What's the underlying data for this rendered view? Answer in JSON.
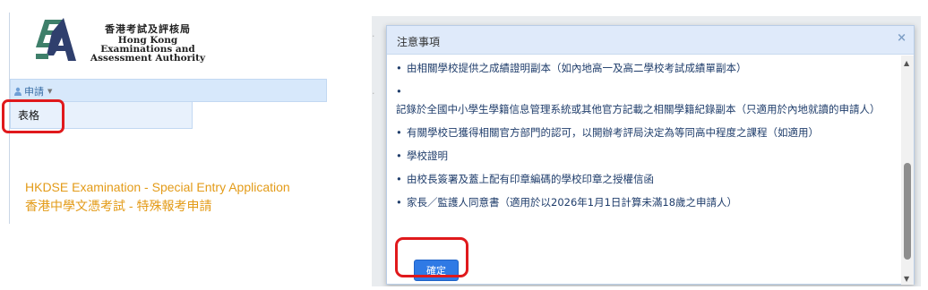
{
  "left": {
    "logo": {
      "chinese_name": "香港考試及評核局",
      "english_line1": "Hong Kong",
      "english_line2": "Examinations and",
      "english_line3": "Assessment Authority"
    },
    "menu": {
      "button_label": "申請",
      "item_label": "表格"
    },
    "page_title_en": "HKDSE Examination - Special Entry Application",
    "page_title_cn": "香港中學文憑考試 - 特殊報考申請"
  },
  "modal": {
    "title": "注意事項",
    "close_symbol": "×",
    "items": [
      "由相關學校提供之成績證明副本（如內地高一及高二學校考試成績單副本）",
      "記錄於全國中小學生學籍信息管理系統或其他官方記載之相關學籍紀錄副本（只適用於內地就讀的申請人）",
      "有關學校已獲得相關官方部門的認可，以開辦考評局決定為等同高中程度之課程（如適用）",
      "學校證明",
      "由校長簽署及蓋上配有印章編碼的學校印章之授權信函",
      "家長／監護人同意書（適用於以2026年1月1日計算未滿18歲之申請人）"
    ],
    "confirm_label": "確定"
  },
  "colors": {
    "highlight": "#e0191c",
    "title_orange": "#e39b18",
    "button_blue": "#2f7ae5",
    "modal_text": "#1f3d6b"
  },
  "icons": [
    "eaa-logo",
    "user-icon",
    "chevron-down-icon",
    "close-icon",
    "scroll-up-icon",
    "scroll-down-icon"
  ]
}
